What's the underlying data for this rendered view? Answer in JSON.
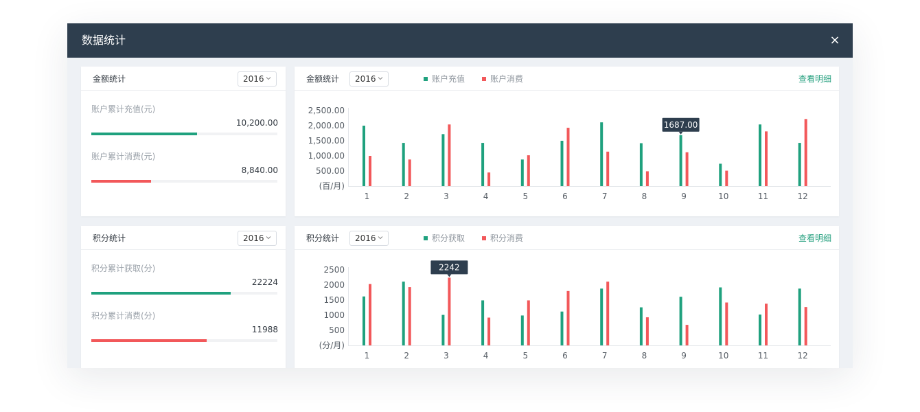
{
  "modal": {
    "title": "数据统计",
    "close_label": "×"
  },
  "colors": {
    "accent_green": "#1fa17e",
    "accent_red": "#f2585a",
    "header_bg": "#2e3e4e",
    "tooltip_bg": "#2e3e4e",
    "link": "#26a07f"
  },
  "amount": {
    "summary": {
      "title": "金额统计",
      "year": "2016",
      "recharge_label": "账户累计充值(元)",
      "recharge_value": "10,200.00",
      "recharge_progress": 0.57,
      "consume_label": "账户累计消费(元)",
      "consume_value": "8,840.00",
      "consume_progress": 0.32
    },
    "chart": {
      "title": "金额统计",
      "year": "2016",
      "legend_recharge": "账户充值",
      "legend_consume": "账户消费",
      "detail_link": "查看明细"
    }
  },
  "points": {
    "summary": {
      "title": "积分统计",
      "year": "2016",
      "earn_label": "积分累计获取(分)",
      "earn_value": "22224",
      "earn_progress": 0.75,
      "consume_label": "积分累计消费(分)",
      "consume_value": "11988",
      "consume_progress": 0.62
    },
    "chart": {
      "title": "积分统计",
      "year": "2016",
      "legend_earn": "积分获取",
      "legend_consume": "积分消费",
      "detail_link": "查看明细"
    }
  },
  "chart_data": [
    {
      "type": "bar",
      "categories": [
        "1",
        "2",
        "3",
        "4",
        "5",
        "6",
        "7",
        "8",
        "9",
        "10",
        "11",
        "12"
      ],
      "series": [
        {
          "name": "账户充值",
          "color": "#1fa17e",
          "values": [
            2000,
            1430,
            1720,
            1430,
            880,
            1500,
            2110,
            1420,
            1687,
            740,
            2040,
            1430
          ]
        },
        {
          "name": "账户消费",
          "color": "#f2585a",
          "values": [
            1000,
            880,
            2040,
            450,
            1020,
            1930,
            1140,
            490,
            1120,
            510,
            1810,
            2220
          ]
        }
      ],
      "ylim": [
        0,
        2500
      ],
      "yticks": [
        "500.00",
        "1,000.00",
        "1,500.00",
        "2,000.00",
        "2,500.00"
      ],
      "ytick_values": [
        500,
        1000,
        1500,
        2000,
        2500
      ],
      "yunit": "(百/月)",
      "tooltip": {
        "category_index": 8,
        "series_index": 0,
        "text": "1687.00"
      },
      "grid": false
    },
    {
      "type": "bar",
      "categories": [
        "1",
        "2",
        "3",
        "4",
        "5",
        "6",
        "7",
        "8",
        "9",
        "10",
        "11",
        "12"
      ],
      "series": [
        {
          "name": "积分获取",
          "color": "#1fa17e",
          "values": [
            1620,
            2110,
            1010,
            1490,
            990,
            1120,
            1880,
            1260,
            1610,
            1920,
            1020,
            1880
          ]
        },
        {
          "name": "积分消费",
          "color": "#f2585a",
          "values": [
            2030,
            1930,
            2242,
            920,
            1490,
            1800,
            2110,
            930,
            680,
            1420,
            1380,
            1270
          ]
        }
      ],
      "ylim": [
        0,
        2500
      ],
      "yticks": [
        "500",
        "1000",
        "1500",
        "2000",
        "2500"
      ],
      "ytick_values": [
        500,
        1000,
        1500,
        2000,
        2500
      ],
      "yunit": "(分/月)",
      "tooltip": {
        "category_index": 2,
        "series_index": 1,
        "text": "2242"
      },
      "grid": false
    }
  ]
}
